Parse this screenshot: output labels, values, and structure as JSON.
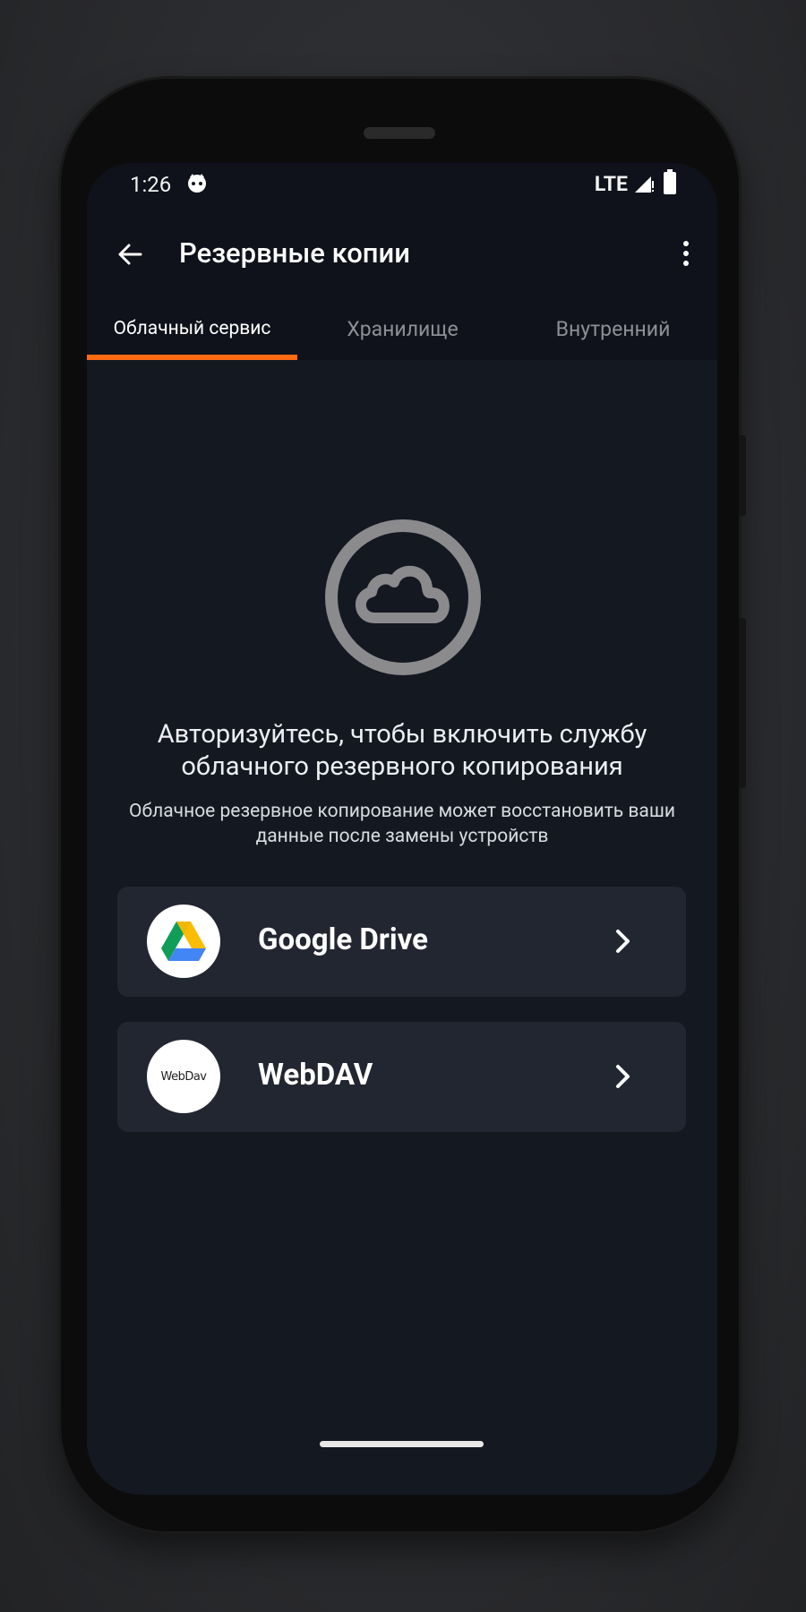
{
  "status_bar": {
    "time": "1:26",
    "network": "LTE",
    "icons": [
      "cat-icon",
      "signal-icon",
      "battery-icon"
    ]
  },
  "app_bar": {
    "title": "Резервные копии",
    "back_icon": "arrow-back-icon",
    "menu_icon": "more-vert-icon"
  },
  "tabs": [
    {
      "label": "Облачный сервис",
      "active": true
    },
    {
      "label": "Хранилище",
      "active": false
    },
    {
      "label": "Внутренний",
      "active": false
    }
  ],
  "content": {
    "icon": "cloud-icon",
    "headline": "Авторизуйтесь, чтобы включить службу облачного резервного копирования",
    "subline": "Облачное резервное копирование может восстановить ваши данные после замены устройств"
  },
  "services": [
    {
      "label": "Google Drive",
      "icon": "google-drive-icon"
    },
    {
      "label": "WebDAV",
      "icon": "webdav-icon",
      "logo_text": "WebDav"
    }
  ],
  "colors": {
    "accent": "#ff6a13",
    "background": "#141821",
    "card": "#222631"
  }
}
